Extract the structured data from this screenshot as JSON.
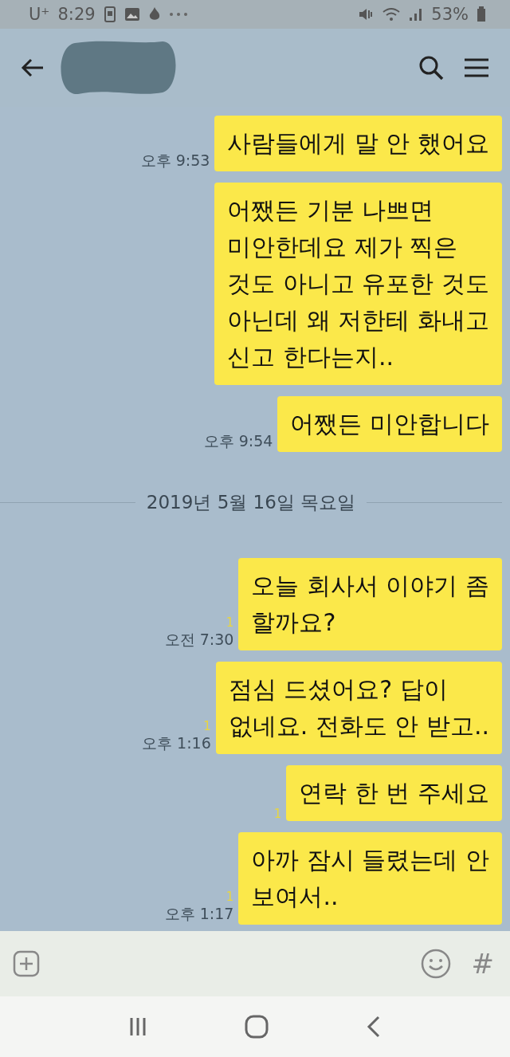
{
  "status_bar": {
    "carrier": "U⁺",
    "time": "8:29",
    "battery": "53%"
  },
  "messages": [
    {
      "kind": "message",
      "lines": [
        "사람들에게 말 안 했어요"
      ],
      "time": "오후 9:53"
    },
    {
      "kind": "message",
      "lines": [
        "어쨌든 기분 나쁘면",
        "미안한데요 제가 찍은",
        "것도 아니고 유포한 것도",
        "아닌데 왜 저한테  화내고",
        "신고 한다는지.."
      ]
    },
    {
      "kind": "message",
      "lines": [
        "어쨌든 미안합니다"
      ],
      "time": "오후 9:54"
    },
    {
      "kind": "date",
      "text": "2019년 5월 16일 목요일"
    },
    {
      "kind": "message",
      "lines": [
        "오늘 회사서 이야기 좀",
        "할까요?"
      ],
      "time": "오전 7:30",
      "unread": "1"
    },
    {
      "kind": "message",
      "lines": [
        "점심 드셨어요? 답이",
        "없네요. 전화도 안 받고.."
      ],
      "time": "오후 1:16",
      "unread": "1"
    },
    {
      "kind": "message",
      "lines": [
        "연락 한 번 주세요"
      ],
      "unread": "1"
    },
    {
      "kind": "message",
      "lines": [
        "아까 잠시 들렸는데 안",
        "보여서.."
      ],
      "time": "오후 1:17",
      "unread": "1"
    }
  ],
  "input_bar": {
    "hash": "#"
  }
}
